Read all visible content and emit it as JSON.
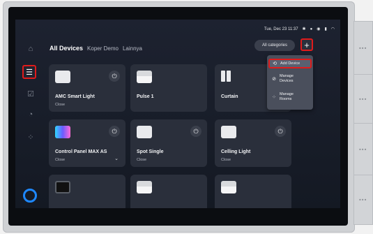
{
  "status": {
    "datetime": "Tue, Dec 23 11:37"
  },
  "tabs": [
    {
      "label": "All Devices",
      "active": true
    },
    {
      "label": "Koper Demo",
      "active": false
    },
    {
      "label": "Lainnya",
      "active": false
    }
  ],
  "topbar": {
    "categories_label": "All categories",
    "add_label": "+"
  },
  "menu": {
    "add_device": "Add Device",
    "manage_devices": "Manage Devices",
    "manage_rooms": "Manage Rooms"
  },
  "cards": [
    {
      "name": "AMC Smart Light",
      "status": "Close"
    },
    {
      "name": "Pulse 1",
      "status": ""
    },
    {
      "name": "Curtain",
      "status": ""
    },
    {
      "name": "Control Panel MAX AS",
      "status": "Close"
    },
    {
      "name": "Spot Single",
      "status": "Close"
    },
    {
      "name": "Celling Light",
      "status": "Close"
    }
  ],
  "colors": {
    "highlight": "#e01b1b",
    "accent": "#1e88ff"
  }
}
